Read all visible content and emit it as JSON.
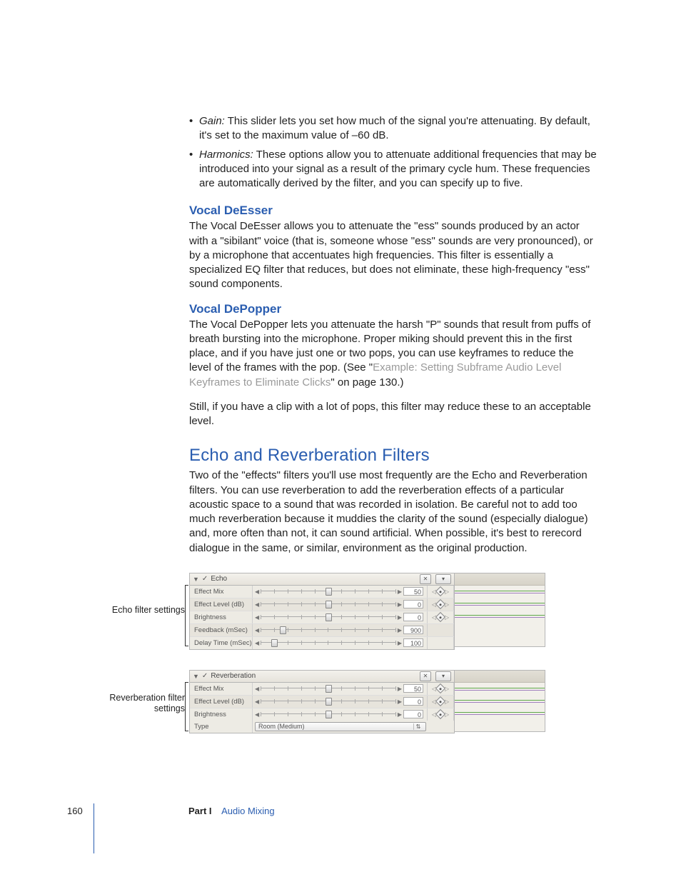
{
  "bullets": [
    {
      "term": "Gain:",
      "text": " This slider lets you set how much of the signal you're attenuating. By default, it's set to the maximum value of –60 dB."
    },
    {
      "term": "Harmonics:",
      "text": " These options allow you to attenuate additional frequencies that may be introduced into your signal as a result of the primary cycle hum. These frequencies are automatically derived by the filter, and you can specify up to five."
    }
  ],
  "deesser": {
    "heading": "Vocal DeEsser",
    "body": "The Vocal DeEsser allows you to attenuate the \"ess\" sounds produced by an actor with a \"sibilant\" voice (that is, someone whose \"ess\" sounds are very pronounced), or by a microphone that accentuates high frequencies. This filter is essentially a specialized EQ filter that reduces, but does not eliminate, these high-frequency \"ess\" sound components."
  },
  "depopper": {
    "heading": "Vocal DePopper",
    "body_pre": "The Vocal DePopper lets you attenuate the harsh \"P\" sounds that result from puffs of breath bursting into the microphone. Proper miking should prevent this in the first place, and if you have just one or two pops, you can use keyframes to reduce the level of the frames with the pop. (See \"",
    "xref": "Example:  Setting Subframe Audio Level Keyframes to Eliminate Clicks",
    "body_post": "\" on page 130.)",
    "body2": "Still, if you have a clip with a lot of pops, this filter may reduce these to an acceptable level."
  },
  "echo_section": {
    "heading": "Echo and Reverberation Filters",
    "body": "Two of the \"effects\" filters you'll use most frequently are the Echo and Reverberation filters. You can use reverberation to add the reverberation effects of a particular acoustic space to a sound that was recorded in isolation. Be careful not to add too much reverberation because it muddies the clarity of the sound (especially dialogue) and, more often than not, it can sound artificial. When possible, it's best to rerecord dialogue in the same, or similar, environment as the original production."
  },
  "echo_panel": {
    "caption": "Echo filter settings",
    "title": "Echo",
    "rows": [
      {
        "label": "Effect Mix",
        "value": "50",
        "pos": 48,
        "kf": true
      },
      {
        "label": "Effect Level (dB)",
        "value": "0",
        "pos": 48,
        "kf": true
      },
      {
        "label": "Brightness",
        "value": "0",
        "pos": 48,
        "kf": true
      },
      {
        "label": "Feedback (mSec)",
        "value": "900",
        "pos": 14,
        "kf": false
      },
      {
        "label": "Delay Time (mSec)",
        "value": "100",
        "pos": 8,
        "kf": false
      }
    ]
  },
  "reverb_panel": {
    "caption": "Reverberation filter settings",
    "title": "Reverberation",
    "rows": [
      {
        "label": "Effect Mix",
        "value": "50",
        "pos": 48,
        "kf": true
      },
      {
        "label": "Effect Level (dB)",
        "value": "0",
        "pos": 48,
        "kf": true
      },
      {
        "label": "Brightness",
        "value": "0",
        "pos": 48,
        "kf": true
      }
    ],
    "type_row": {
      "label": "Type",
      "value": "Room (Medium)"
    }
  },
  "footer": {
    "page": "160",
    "part_label": "Part I",
    "part_title": "Audio Mixing"
  }
}
